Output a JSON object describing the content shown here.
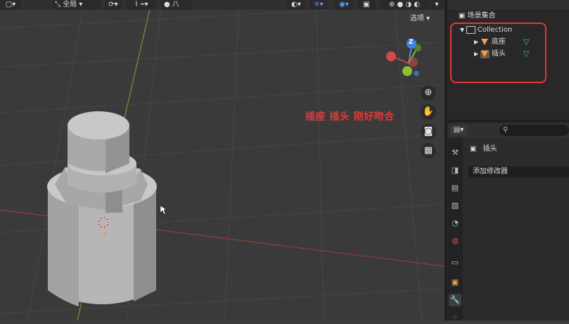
{
  "viewport": {
    "header": {
      "orientation_label": "全局",
      "pivot_label": "八",
      "options_label": "选项"
    },
    "gizmo": {
      "z_label": "Z"
    },
    "annotation": "插座 插头 刚好吻合",
    "nav_icons": [
      "zoom-icon",
      "hand-icon",
      "camera-icon",
      "grid-icon"
    ]
  },
  "outliner": {
    "header_title": "场景集合",
    "collection_label": "Collection",
    "objects": [
      {
        "label": "底座",
        "icon": "mesh-object-icon"
      },
      {
        "label": "插头",
        "icon": "mesh-object-icon"
      }
    ],
    "highlight_color": "#e53935"
  },
  "properties": {
    "object_name": "插头",
    "add_modifier_label": "添加修改器",
    "search_placeholder": ""
  },
  "colors": {
    "annotation": "#e03a3a",
    "mesh_icon": "#f0a04b",
    "data_icon": "#3ec45f",
    "accent": "#5aa0ff"
  }
}
